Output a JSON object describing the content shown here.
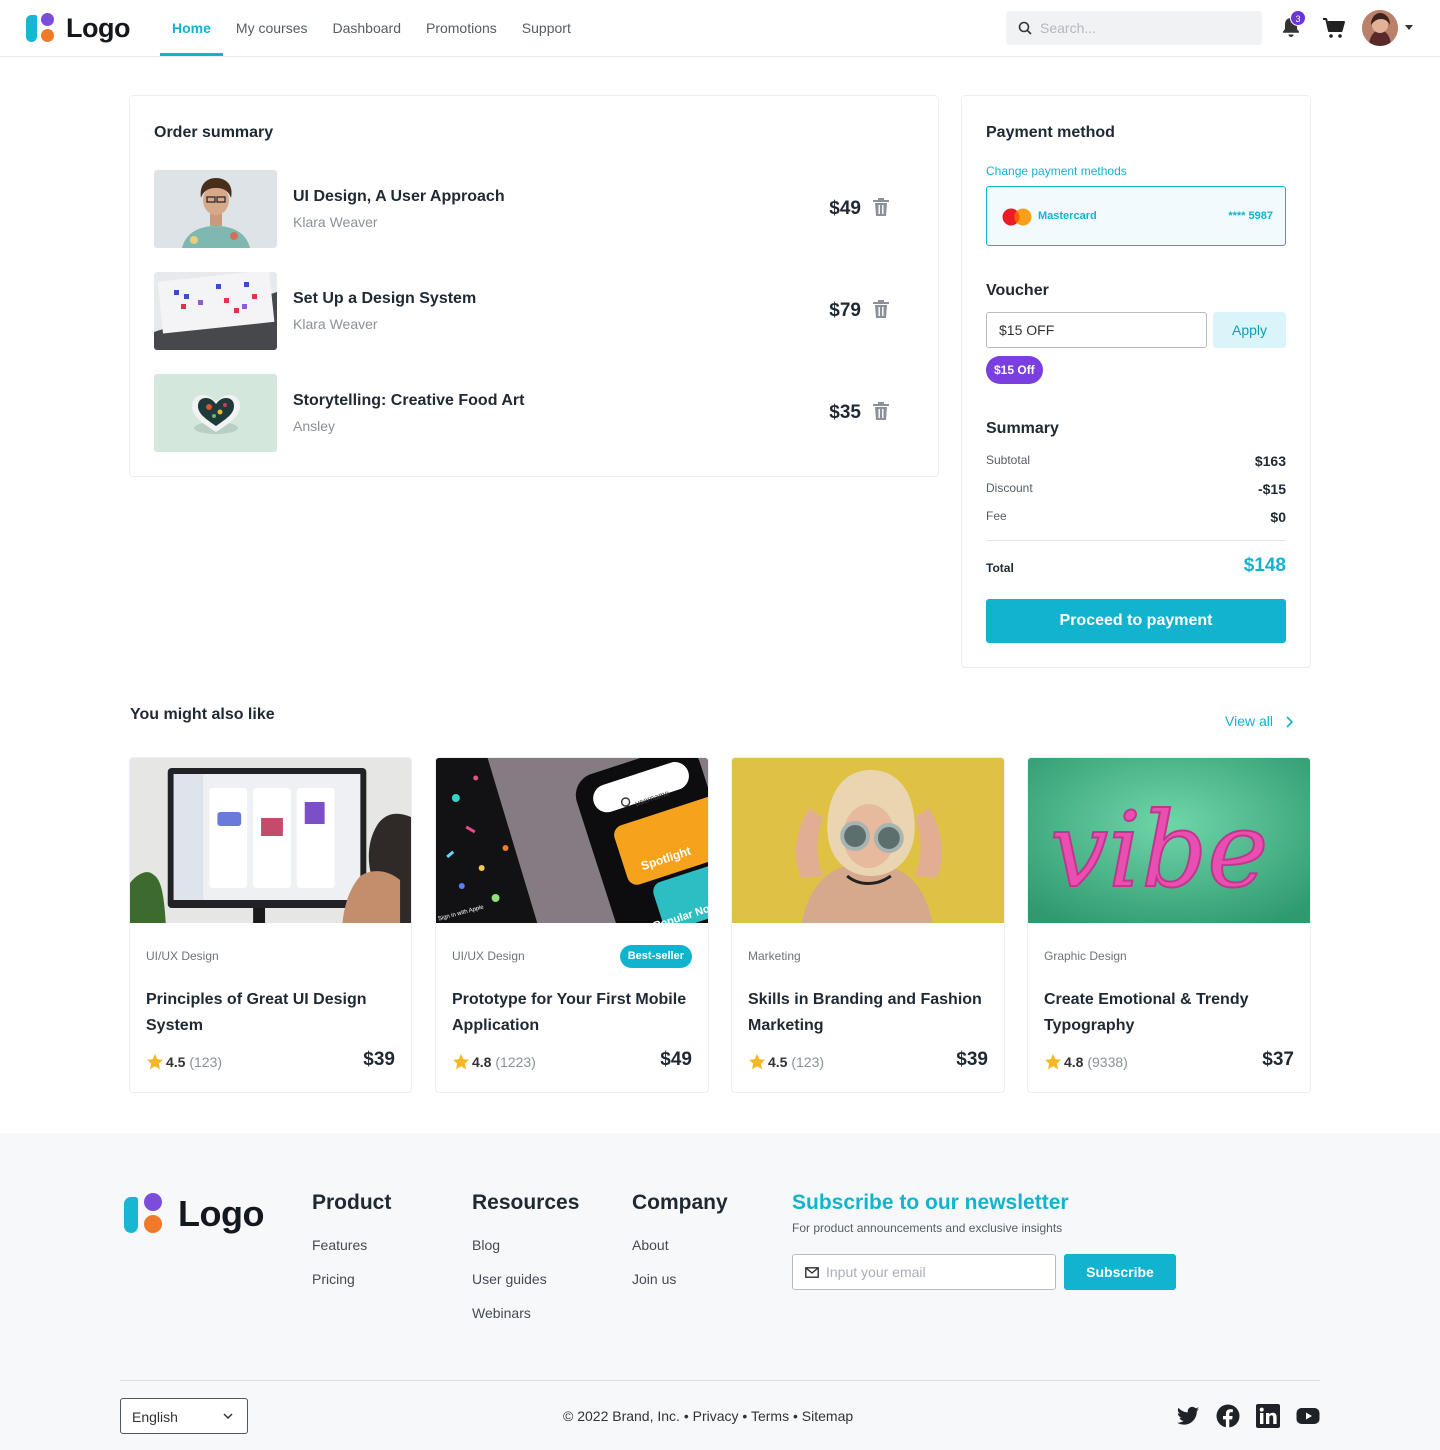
{
  "header": {
    "logo_text": "Logo",
    "nav": [
      {
        "label": "Home",
        "active": true
      },
      {
        "label": "My courses"
      },
      {
        "label": "Dashboard"
      },
      {
        "label": "Promotions"
      },
      {
        "label": "Support"
      }
    ],
    "search_placeholder": "Search...",
    "notification_count": "3",
    "icons": {
      "search": "search-icon",
      "bell": "bell-icon",
      "cart": "cart-icon",
      "avatar": "avatar",
      "caret": "caret-down-icon"
    }
  },
  "order": {
    "title": "Order summary",
    "items": [
      {
        "title": "UI Design, A User Approach",
        "author": "Klara Weaver",
        "price": "$49"
      },
      {
        "title": "Set Up a Design System",
        "author": "Klara Weaver",
        "price": "$79"
      },
      {
        "title": "Storytelling: Creative Food Art",
        "author": "Ansley",
        "price": "$35"
      }
    ]
  },
  "payment": {
    "title": "Payment method",
    "change_link": "Change payment methods",
    "card_name": "Mastercard",
    "card_number": "**** 5987",
    "voucher_title": "Voucher",
    "voucher_value": "$15 OFF",
    "apply_label": "Apply",
    "applied_chip": "$15 Off",
    "summary_title": "Summary",
    "rows": [
      {
        "label": "Subtotal",
        "value": "$163"
      },
      {
        "label": "Discount",
        "value": "-$15"
      },
      {
        "label": "Fee",
        "value": "$0"
      }
    ],
    "total_label": "Total",
    "total_value": "$148",
    "proceed_label": "Proceed to payment"
  },
  "recommended": {
    "title": "You might also like",
    "view_all": "View all",
    "courses": [
      {
        "category": "UI/UX Design",
        "title": "Principles of Great UI Design System",
        "rating": "4.5",
        "count": "(123)",
        "price": "$39",
        "badge": ""
      },
      {
        "category": "UI/UX Design",
        "title": "Prototype for Your First Mobile Application",
        "rating": "4.8",
        "count": "(1223)",
        "price": "$49",
        "badge": "Best-seller"
      },
      {
        "category": "Marketing",
        "title": "Skills in Branding and Fashion Marketing",
        "rating": "4.5",
        "count": "(123)",
        "price": "$39",
        "badge": ""
      },
      {
        "category": "Graphic Design",
        "title": "Create Emotional & Trendy Typography",
        "rating": "4.8",
        "count": "(9338)",
        "price": "$37",
        "badge": ""
      }
    ],
    "image_texts": {
      "search_field": "username",
      "spotlight": "Spotlight",
      "popular": "Popular No",
      "sign_in": "Sign in with Apple",
      "vibe": "vibe"
    }
  },
  "footer": {
    "logo_text": "Logo",
    "columns": [
      {
        "title": "Product",
        "links": [
          "Features",
          "Pricing"
        ]
      },
      {
        "title": "Resources",
        "links": [
          "Blog",
          "User guides",
          "Webinars"
        ]
      },
      {
        "title": "Company",
        "links": [
          "About",
          "Join us"
        ]
      }
    ],
    "newsletter_title": "Subscribe to our newsletter",
    "newsletter_sub": "For product announcements and exclusive insights",
    "email_placeholder": "Input your email",
    "subscribe_label": "Subscribe",
    "language": "English",
    "copyright": "© 2022 Brand, Inc.",
    "legal_links": [
      "Privacy",
      "Terms",
      "Sitemap"
    ],
    "social": [
      "twitter-icon",
      "facebook-icon",
      "linkedin-icon",
      "youtube-icon"
    ]
  },
  "colors": {
    "accent": "#12b3cf",
    "purple": "#7b3ee0",
    "orange": "#f07a2a",
    "text": "#1f2933"
  }
}
